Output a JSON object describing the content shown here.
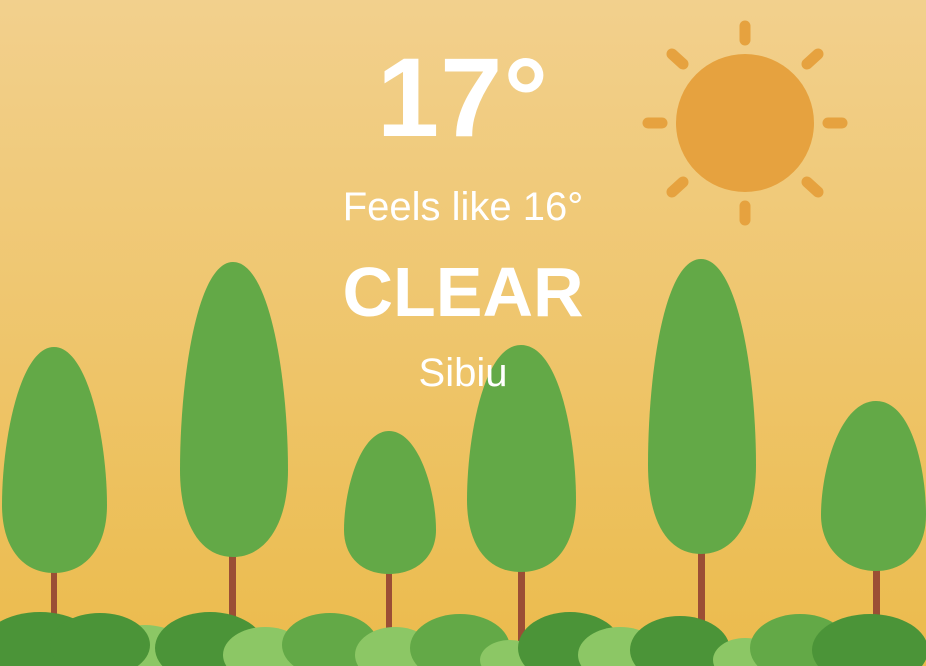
{
  "weather": {
    "temperature": "17°",
    "feels_like": "Feels like 16°",
    "condition": "CLEAR",
    "location": "Sibiu"
  },
  "colors": {
    "sky_top": "#f1cf8a",
    "sky_bottom": "#ecbd4f",
    "sun": "#e6a23f",
    "tree_green": "#63a947",
    "trunk": "#9b4e35",
    "bush_dark": "#4b9438",
    "bush_light": "#8cc765",
    "text": "#ffffff"
  },
  "icons": {
    "sun": "sun-icon"
  }
}
